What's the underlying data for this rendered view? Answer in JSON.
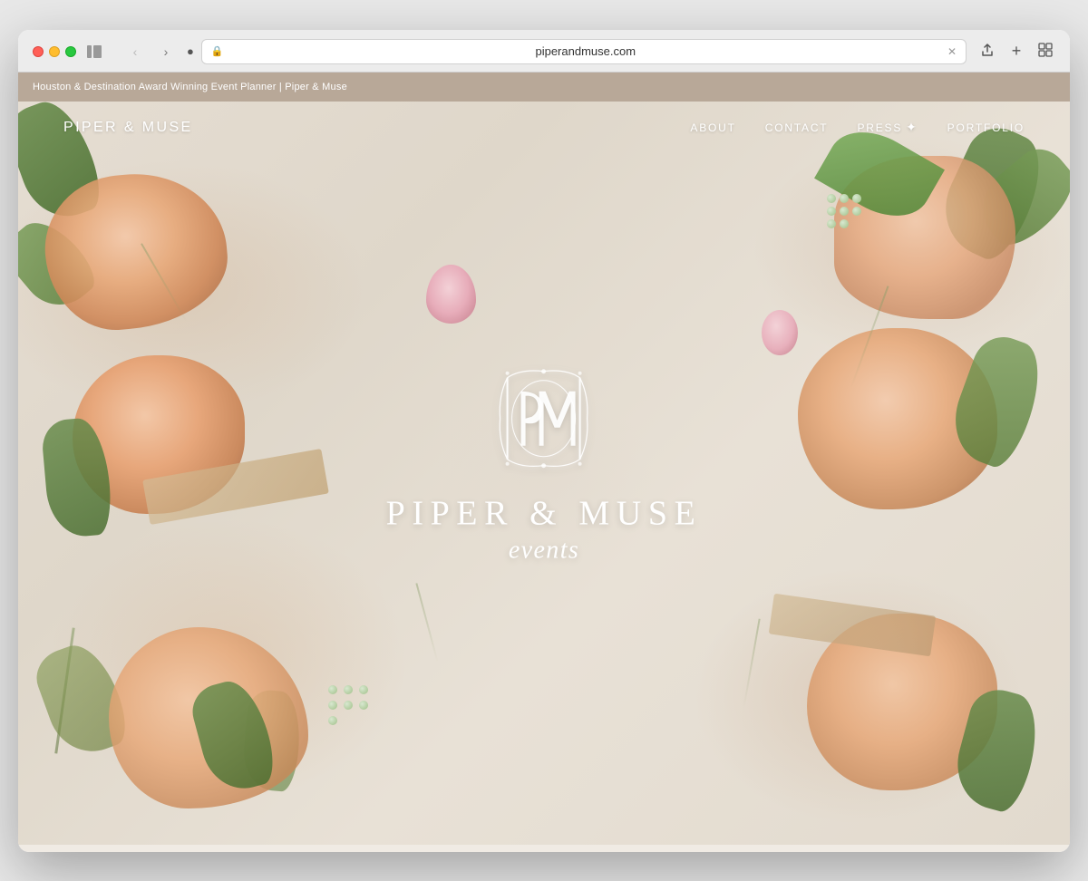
{
  "browser": {
    "url": "piperandmuse.com",
    "tab_title": "Houston & Destination Award Winning Event Planner | Piper & Muse",
    "back_label": "‹",
    "forward_label": "›"
  },
  "site": {
    "tab_bar_text": "Houston & Destination Award Winning Event Planner | Piper & Muse",
    "logo": "PIPER & MUSE",
    "center_title": "PIPER & MUSE",
    "center_subtitle": "events",
    "nav": {
      "about": "ABOUT",
      "contact": "CONTACT",
      "press": "PRESS",
      "portfolio": "PORTFOLIO"
    },
    "monogram_label": "PM monogram"
  }
}
